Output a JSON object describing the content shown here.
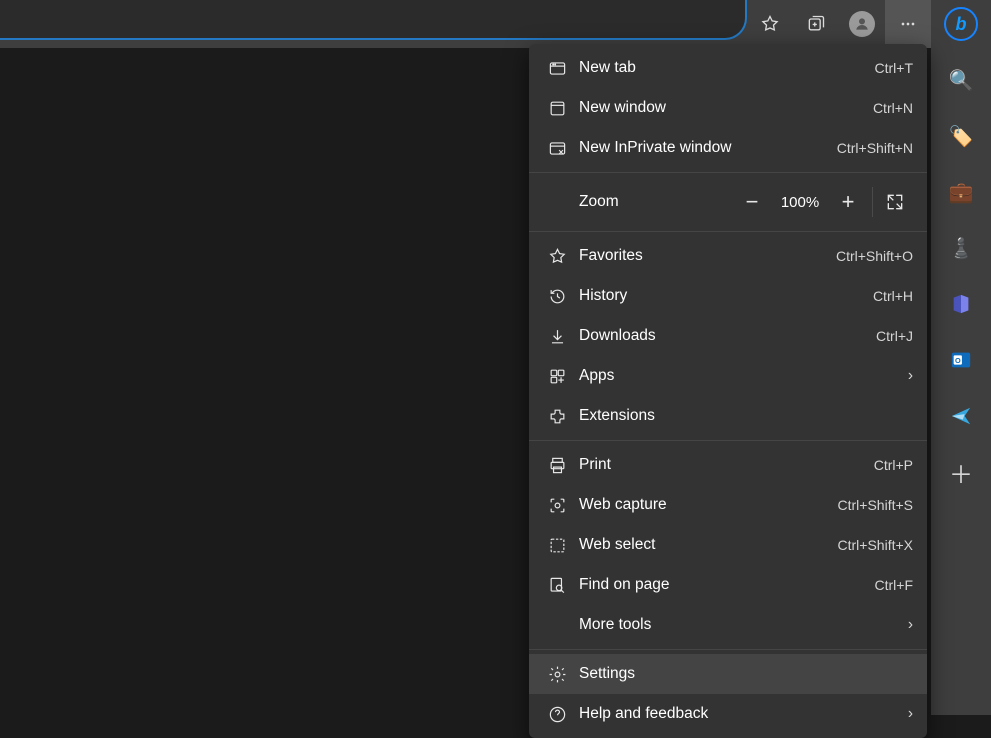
{
  "toolbar": {
    "icons": {
      "add_favorite": "add-favorite-icon",
      "favorites": "favorites-icon",
      "collections": "collections-icon",
      "profile": "profile-icon",
      "more": "more-icon"
    }
  },
  "sidebar": {
    "items": [
      {
        "name": "bing-chat-icon"
      },
      {
        "name": "search-icon",
        "emoji": "🔍"
      },
      {
        "name": "shopping-icon",
        "emoji": "🏷️"
      },
      {
        "name": "tools-icon",
        "emoji": "💼"
      },
      {
        "name": "games-icon",
        "emoji": "♟️"
      },
      {
        "name": "office-icon",
        "emoji": "🏢"
      },
      {
        "name": "outlook-icon",
        "emoji": "📧"
      },
      {
        "name": "send-icon",
        "emoji": "✈️"
      },
      {
        "name": "add-icon",
        "emoji": "＋"
      }
    ]
  },
  "menu": {
    "new_tab": {
      "label": "New tab",
      "shortcut": "Ctrl+T"
    },
    "new_window": {
      "label": "New window",
      "shortcut": "Ctrl+N"
    },
    "new_inprivate": {
      "label": "New InPrivate window",
      "shortcut": "Ctrl+Shift+N"
    },
    "zoom": {
      "label": "Zoom",
      "value": "100%"
    },
    "favorites": {
      "label": "Favorites",
      "shortcut": "Ctrl+Shift+O"
    },
    "history": {
      "label": "History",
      "shortcut": "Ctrl+H"
    },
    "downloads": {
      "label": "Downloads",
      "shortcut": "Ctrl+J"
    },
    "apps": {
      "label": "Apps"
    },
    "extensions": {
      "label": "Extensions"
    },
    "print": {
      "label": "Print",
      "shortcut": "Ctrl+P"
    },
    "web_capture": {
      "label": "Web capture",
      "shortcut": "Ctrl+Shift+S"
    },
    "web_select": {
      "label": "Web select",
      "shortcut": "Ctrl+Shift+X"
    },
    "find": {
      "label": "Find on page",
      "shortcut": "Ctrl+F"
    },
    "more_tools": {
      "label": "More tools"
    },
    "settings": {
      "label": "Settings"
    },
    "help": {
      "label": "Help and feedback"
    }
  }
}
